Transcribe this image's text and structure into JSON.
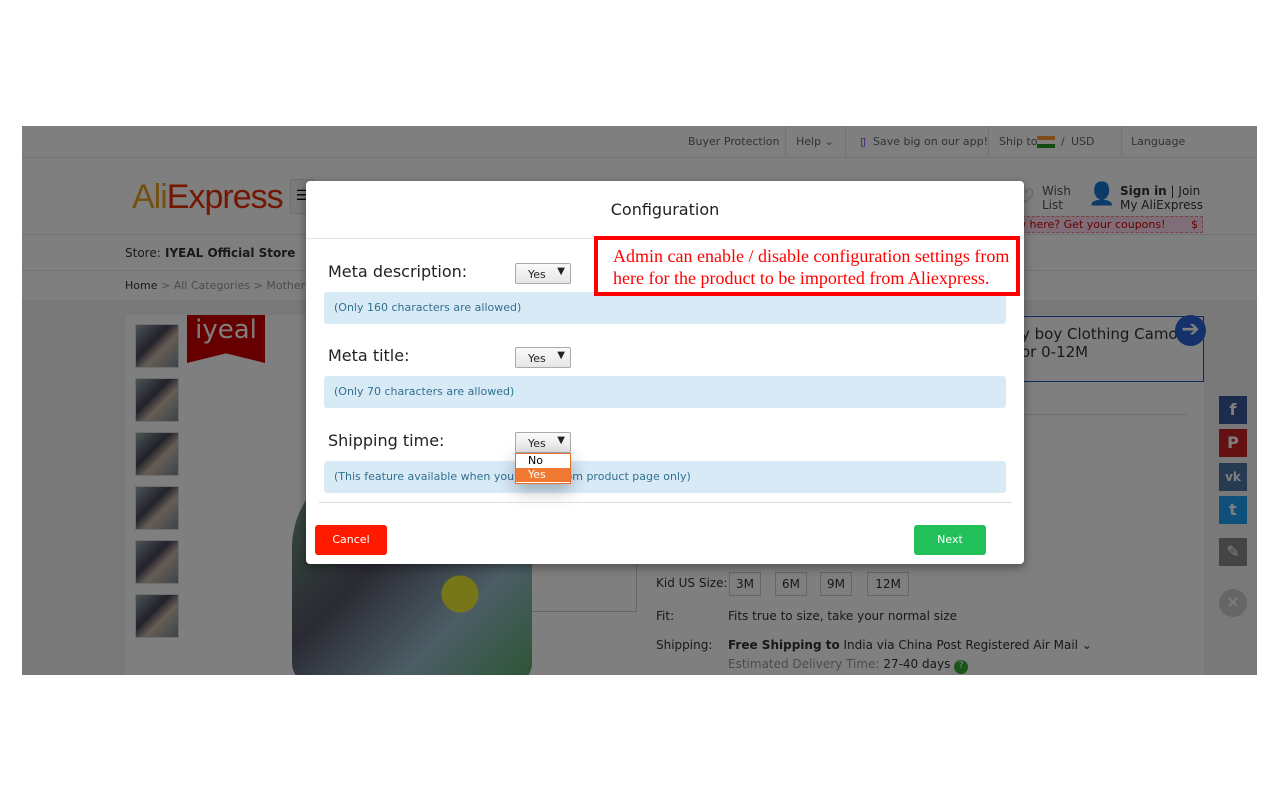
{
  "site": {
    "topbar": {
      "buyer_protection": "Buyer Protection",
      "help": "Help",
      "app": "Save big on our app!",
      "ship_to": "Ship to",
      "currency": "USD",
      "language": "Language"
    },
    "logo": {
      "part1": "Ali",
      "part2": "Express"
    },
    "header": {
      "wish": "Wish",
      "list": "List",
      "sign_in": "Sign in",
      "join": "Join",
      "my_account": "My AliExpress",
      "coupon": "w here? Get your coupons!",
      "coupon_symbol": "$"
    },
    "store": {
      "label": "Store:",
      "name": "IYEAL Official Store"
    },
    "breadcrumb": [
      "Home",
      "All Categories",
      "Mother &"
    ],
    "brand_badge": "iyeal",
    "product_title": [
      "y boy Clothing Camo",
      "or 0-12M"
    ],
    "size_label": "Kid US Size:",
    "sizes": [
      "3M",
      "6M",
      "9M",
      "12M"
    ],
    "fit_label": "Fit:",
    "fit_value": "Fits true to size, take your normal size",
    "shipping_label": "Shipping:",
    "shipping_bold": "Free Shipping to",
    "shipping_value": "India via China Post Registered Air Mail",
    "delivery_label": "Estimated Delivery Time:",
    "delivery_value": "27-40",
    "delivery_unit": "days"
  },
  "modal": {
    "title": "Configuration",
    "fields": [
      {
        "label": "Meta description:",
        "value": "Yes",
        "hint": "(Only 160 characters are allowed)"
      },
      {
        "label": "Meta title:",
        "value": "Yes",
        "hint": "(Only 70 characters are allowed)"
      },
      {
        "label": "Shipping time:",
        "value": "Yes",
        "hint": "(This feature available when you import from product page only)"
      }
    ],
    "dropdown_options": [
      "No",
      "Yes"
    ],
    "dropdown_highlighted": "Yes",
    "cancel": "Cancel",
    "next": "Next",
    "colors": {
      "cancel": "#ff1a00",
      "next": "#22c05a",
      "highlight": "#f07830"
    }
  },
  "annotation": {
    "text": "Admin can enable / disable configuration settings from here for the product to be imported from Aliexpress.",
    "color": "#ff0000"
  }
}
